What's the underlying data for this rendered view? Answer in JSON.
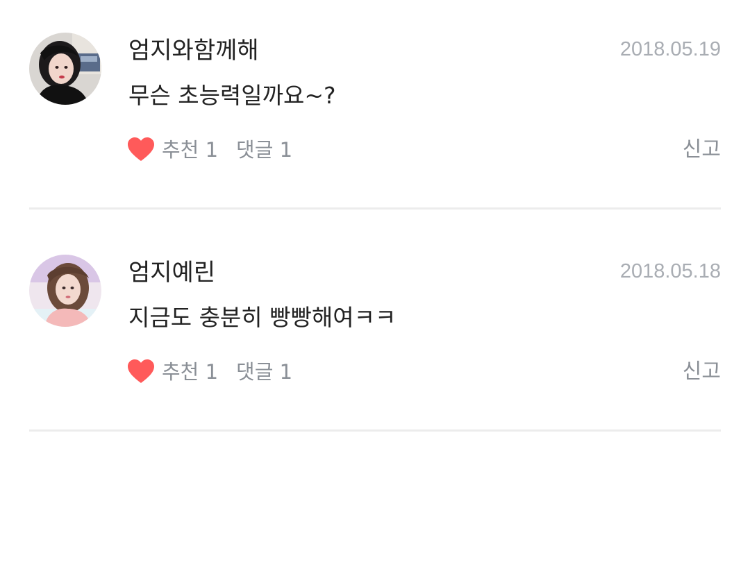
{
  "comments": [
    {
      "author": "엄지와함께해",
      "date": "2018.05.19",
      "text": "무슨 초능력일까요~?",
      "like_label": "추천 1",
      "reply_label": "댓글 1",
      "report_label": "신고",
      "like_icon": "heart-icon",
      "like_color": "#ff5a5a"
    },
    {
      "author": "엄지예린",
      "date": "2018.05.18",
      "text": "지금도 충분히 빵빵해여ㅋㅋ",
      "like_label": "추천 1",
      "reply_label": "댓글 1",
      "report_label": "신고",
      "like_icon": "heart-icon",
      "like_color": "#ff5a5a"
    }
  ]
}
